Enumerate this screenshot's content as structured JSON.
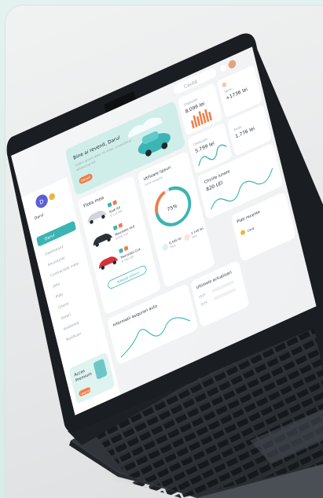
{
  "dashboard": {
    "welcome": {
      "title": "Bine ai revenit, Darul",
      "line1": "Lorem ipsum dolor sit amet, consectetur",
      "line2": "adipiscing elit",
      "button": "Detalii"
    },
    "sidebar": {
      "profile_name": "Darul",
      "profile_sub": "Client",
      "active_item": "Darul",
      "items": [
        "Dashboard",
        "Anunturile",
        "Contractele mele",
        "Jobs",
        "Plăți",
        "Clienti",
        "Setari",
        "Asistenta",
        "Notificari"
      ]
    },
    "fleet": {
      "title": "Flota mea",
      "cars": [
        {
          "name": "Audi A4",
          "plate": "B 123 ABC"
        },
        {
          "name": "Mercedes GLE",
          "plate": "B 456 XYZ"
        },
        {
          "name": "Mercedes CLA",
          "plate": "B 789 DEF"
        }
      ],
      "add_button": "Adaugă vehicul"
    },
    "usage": {
      "title": "Utilizare lipsuri",
      "subtitle": "Luna aceasta",
      "percent": "75%",
      "stat1_value": "6.435 lei",
      "stat1_label": "Total",
      "stat2_value": "2.145 lei",
      "stat2_label": "Rest"
    },
    "kpis": [
      {
        "label": "Cheltuieli",
        "value": "8.099 lei"
      },
      {
        "label": "Venit",
        "value": "+1736 lei"
      },
      {
        "label": "Cheltuieli",
        "value": "5.799 lei"
      },
      {
        "label": "Profit",
        "value": "1.776 lei"
      }
    ],
    "monthly": {
      "title": "Chiriile lunare",
      "value": "820 LEI"
    },
    "insurance": {
      "title": "Informatii asigurari auto"
    },
    "recent": {
      "title": "Ultimele actualizari",
      "items": [
        "2023",
        "2024"
      ]
    },
    "payment": {
      "title": "Plati recente",
      "method": "Card"
    },
    "promo": {
      "title": "Acces",
      "subtitle": "Premium",
      "button": "Upgrade"
    },
    "topbar": {
      "search": "Caută"
    }
  },
  "colors": {
    "accent": "#3cb4b4",
    "orange": "#f07c4a",
    "laptop_dark": "#22262b"
  }
}
